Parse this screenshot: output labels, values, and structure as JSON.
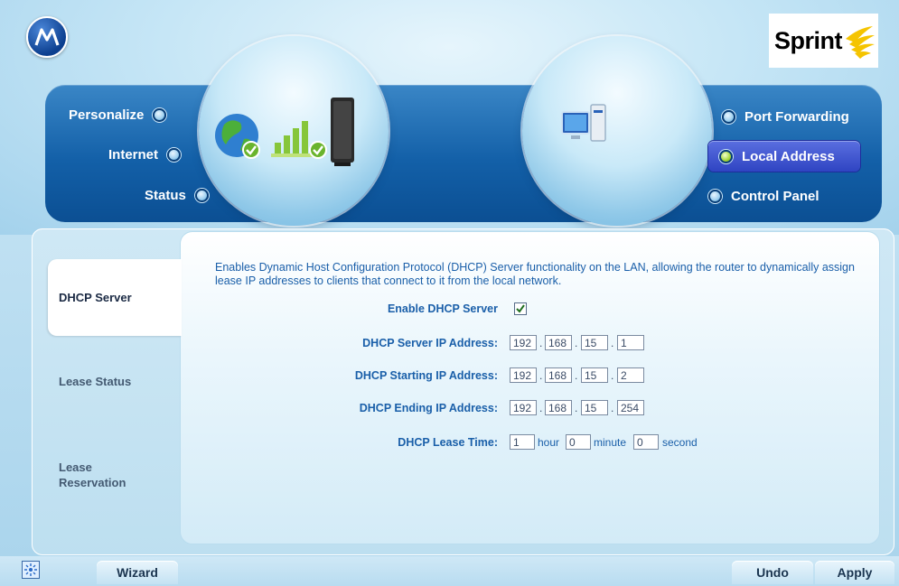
{
  "brand": {
    "carrier_logo_text": "Sprint"
  },
  "nav": {
    "left": [
      {
        "label": "Personalize"
      },
      {
        "label": "Internet"
      },
      {
        "label": "Status"
      }
    ],
    "right": [
      {
        "label": "Port Forwarding"
      },
      {
        "label": "Local Address",
        "active": true
      },
      {
        "label": "Control Panel"
      }
    ]
  },
  "sidebar": {
    "tabs": [
      {
        "label": "DHCP Server",
        "active": true
      },
      {
        "label": "Lease Status"
      },
      {
        "label": "Lease Reservation"
      }
    ]
  },
  "main": {
    "description": "Enables Dynamic Host Configuration Protocol (DHCP) Server functionality on the LAN, allowing the router to dynamically assign lease IP addresses to clients that connect to it from the local network.",
    "enable_label": "Enable DHCP Server",
    "enable_checked": true,
    "server_ip_label": "DHCP Server IP Address:",
    "server_ip": [
      "192",
      "168",
      "15",
      "1"
    ],
    "start_ip_label": "DHCP Starting IP Address:",
    "start_ip": [
      "192",
      "168",
      "15",
      "2"
    ],
    "end_ip_label": "DHCP Ending IP Address:",
    "end_ip": [
      "192",
      "168",
      "15",
      "254"
    ],
    "lease_label": "DHCP Lease Time:",
    "lease": {
      "hours": "1",
      "hours_unit": "hour",
      "minutes": "0",
      "minutes_unit": "minute",
      "seconds": "0",
      "seconds_unit": "second"
    }
  },
  "footer": {
    "wizard_label": "Wizard",
    "undo_label": "Undo",
    "apply_label": "Apply"
  },
  "colors": {
    "nav_band": "#1360a8",
    "label_blue": "#1a5fa9",
    "active_dot": "#a6d63a"
  }
}
